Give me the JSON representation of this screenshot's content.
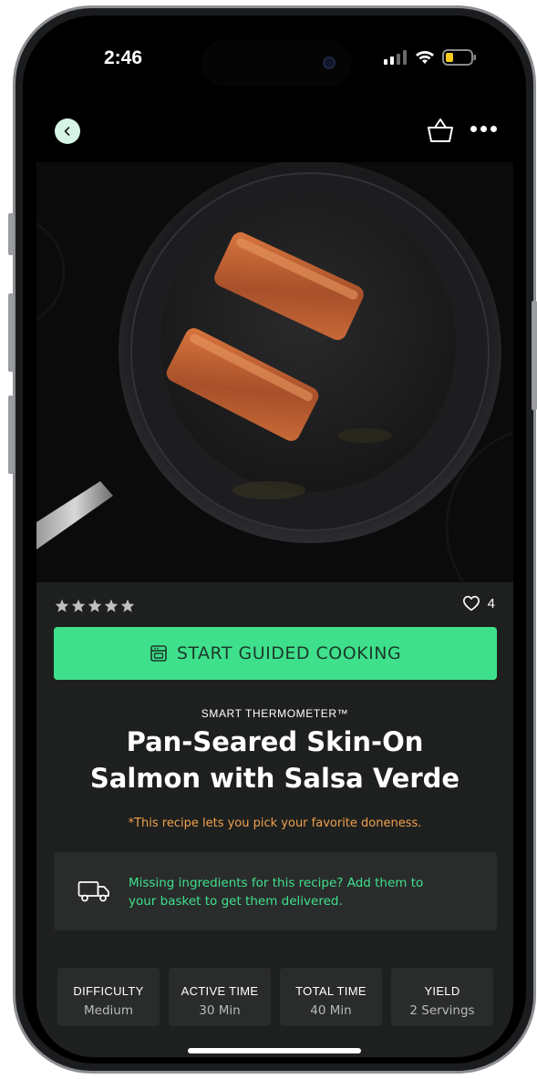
{
  "status_bar": {
    "time": "2:46"
  },
  "app_bar": {
    "back_icon": "chevron-left-icon",
    "basket_icon": "basket-icon",
    "more_icon": "more-horizontal-icon"
  },
  "hero": {
    "image": "salmon-fillets-in-pan"
  },
  "rating": {
    "stars": 5,
    "like_count": "4"
  },
  "cta": {
    "label": "START GUIDED COOKING",
    "icon": "oven-icon"
  },
  "recipe": {
    "kicker": "SMART THERMOMETER™",
    "title_line1": "Pan-Seared Skin-On",
    "title_line2": "Salmon with Salsa Verde",
    "note": "*This recipe lets you pick your favorite doneness."
  },
  "missing": {
    "icon": "truck-icon",
    "line1": "Missing ingredients for this recipe? Add them to",
    "line2": "your basket to get them delivered."
  },
  "stats": [
    {
      "label": "DIFFICULTY",
      "value": "Medium"
    },
    {
      "label": "ACTIVE TIME",
      "value": "30 Min"
    },
    {
      "label": "TOTAL TIME",
      "value": "40 Min"
    },
    {
      "label": "YIELD",
      "value": "2 Servings"
    }
  ],
  "colors": {
    "accent": "#3fe08c",
    "note": "#f0a04b",
    "background": "#1e201f",
    "card": "#2a2c2b"
  }
}
